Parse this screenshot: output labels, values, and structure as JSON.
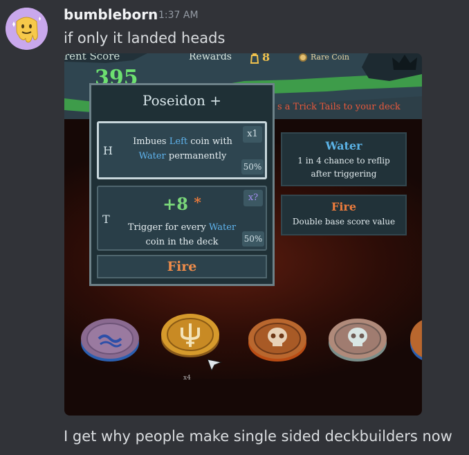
{
  "message": {
    "author": "bumbleborn",
    "timestamp": "1:37 AM",
    "text": "if only it landed heads",
    "followup_text": "I get why people make single sided deckbuilders now"
  },
  "game": {
    "score_label": "rent Score",
    "score_value": "395",
    "rewards_label": "Rewards",
    "rewards_count": "8",
    "reward_item": "Rare Coin",
    "trick_text": "s a Trick Tails to your deck",
    "card": {
      "title": "Poseidon +",
      "heads": {
        "letter": "H",
        "multiplier": "x1",
        "chance": "50%",
        "text_pre": "Imbues",
        "highlight1": "Left",
        "text_mid": "coin with",
        "highlight2": "Water",
        "text_post": "permanently"
      },
      "tails": {
        "letter": "T",
        "multiplier": "x?",
        "chance": "50%",
        "value": "+8",
        "asterisk": "*",
        "text_pre": "Trigger for every",
        "highlight": "Water",
        "text_post": "coin in the deck"
      },
      "footer": "Fire"
    },
    "tooltips": [
      {
        "title": "Water",
        "desc": "1 in 4 chance to reflip after triggering"
      },
      {
        "title": "Fire",
        "desc": "Double base score value"
      }
    ],
    "coin_count": "x4",
    "colors": {
      "water": "#5fb4ee",
      "fire": "#ef7c3c",
      "score": "#6de070"
    }
  }
}
